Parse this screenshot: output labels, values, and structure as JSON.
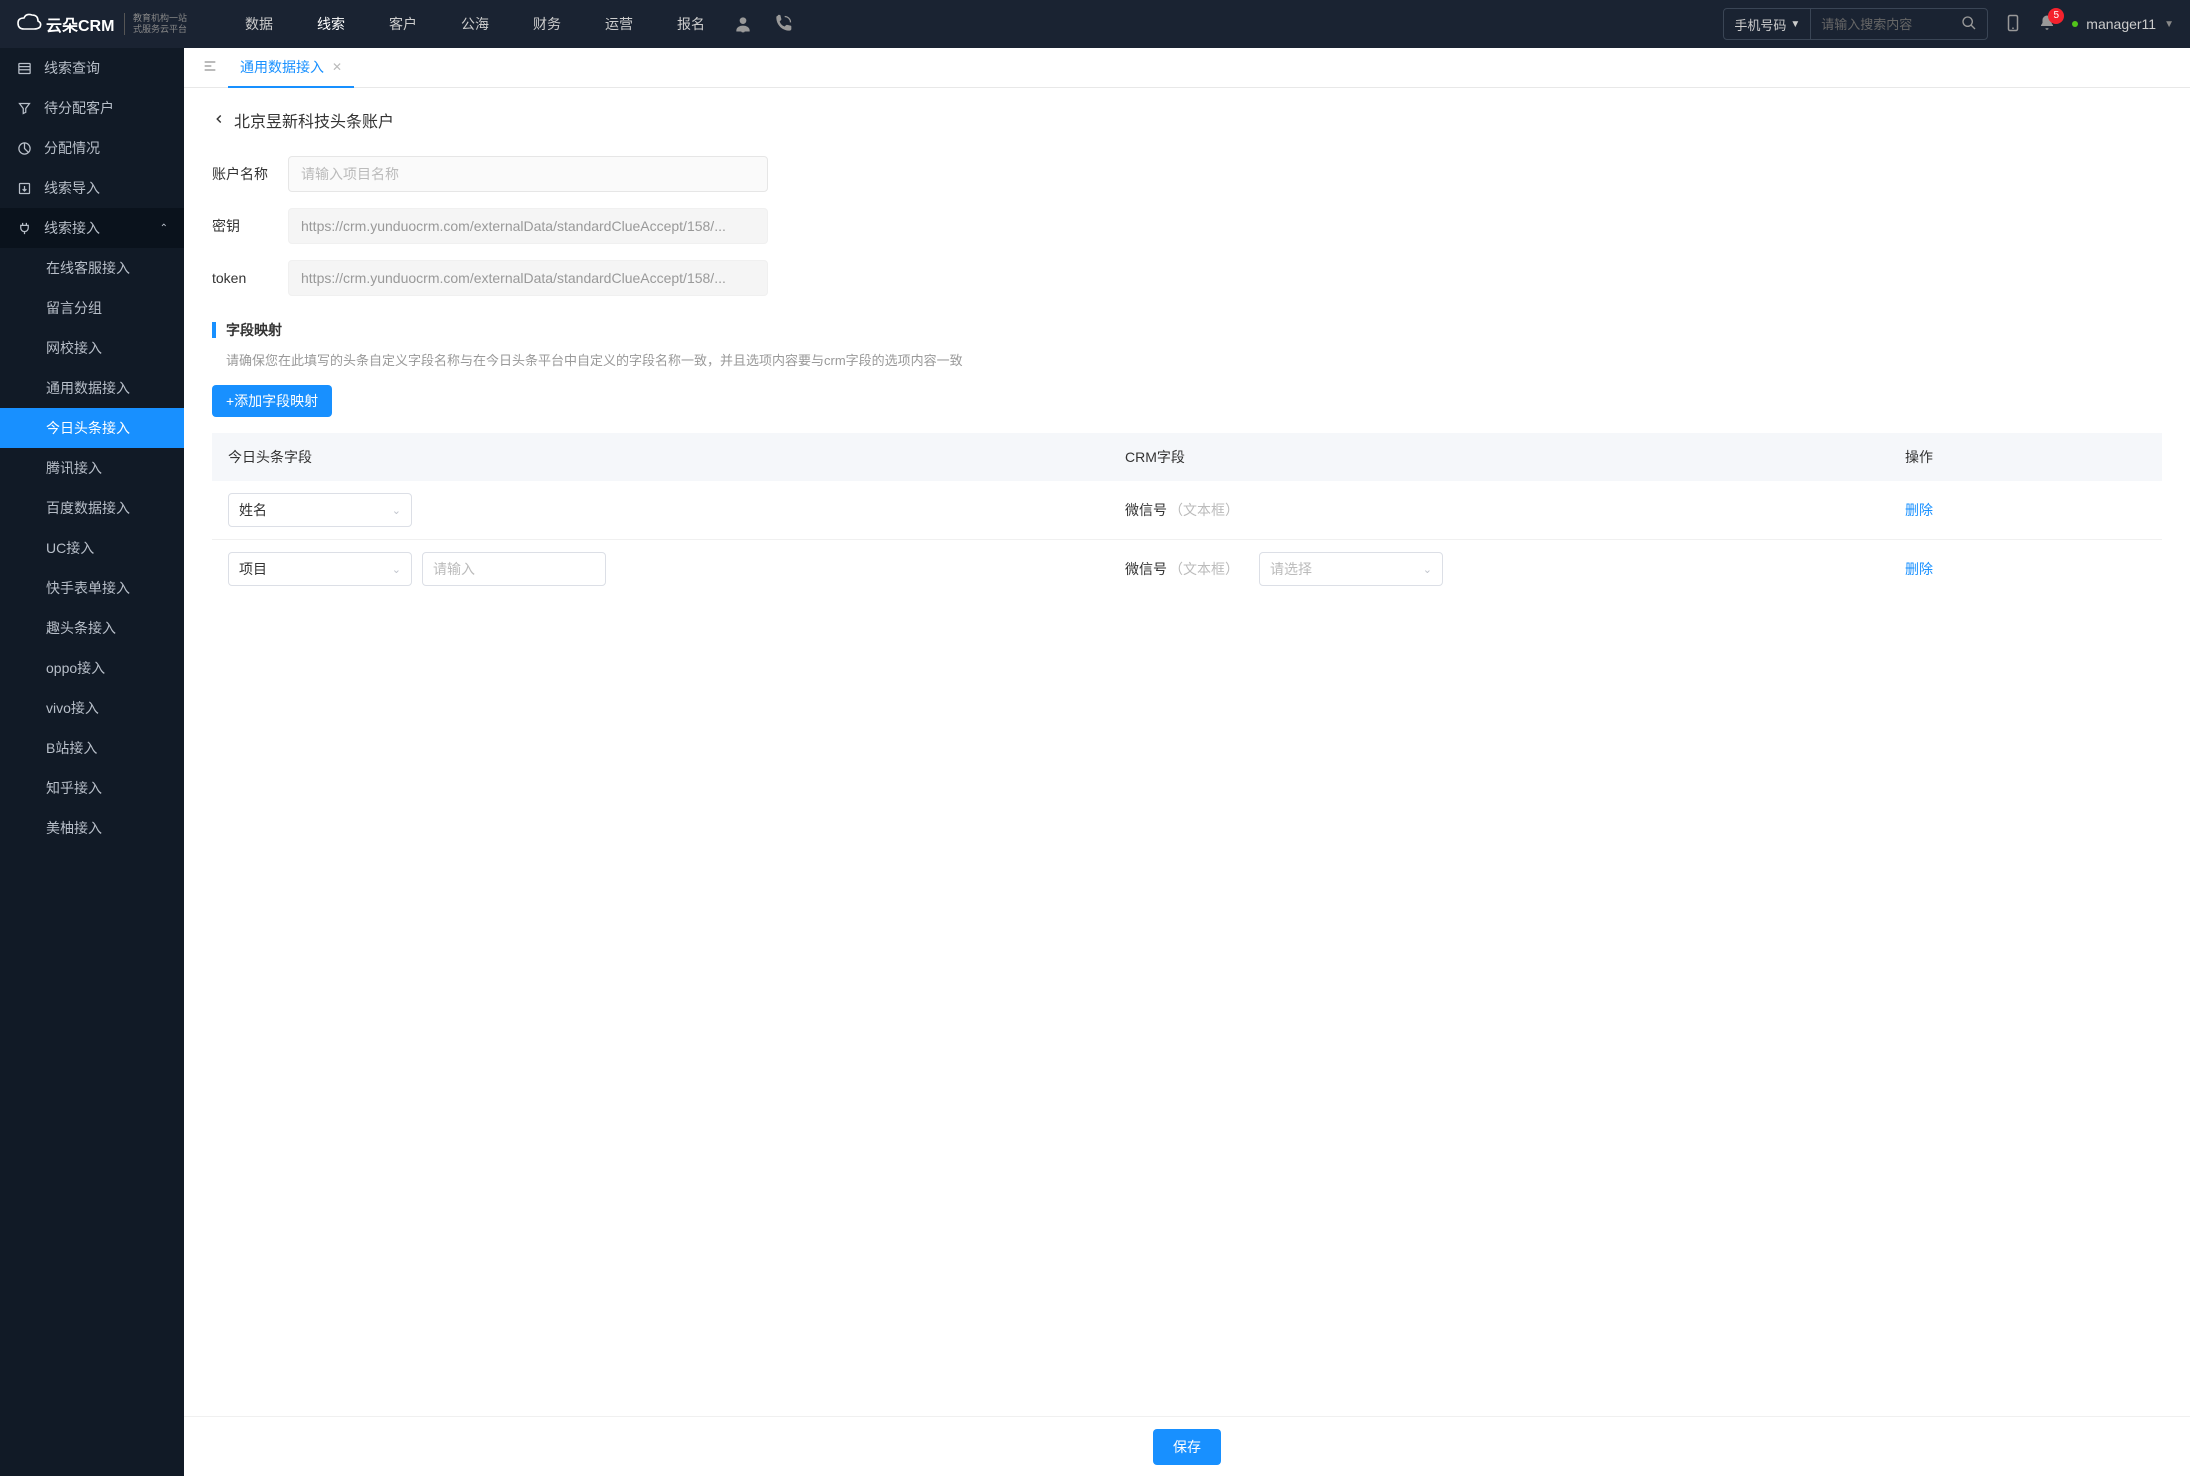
{
  "logoText": "云朵CRM",
  "logoSub1": "教育机构一站",
  "logoSub2": "式服务云平台",
  "nav": [
    "数据",
    "线索",
    "客户",
    "公海",
    "财务",
    "运营",
    "报名"
  ],
  "navActiveIndex": 1,
  "search": {
    "type": "手机号码",
    "placeholder": "请输入搜索内容"
  },
  "badge": "5",
  "user": "manager11",
  "sidebar": {
    "items": [
      {
        "label": "线索查询"
      },
      {
        "label": "待分配客户"
      },
      {
        "label": "分配情况"
      },
      {
        "label": "线索导入"
      },
      {
        "label": "线索接入",
        "expanded": true
      }
    ],
    "subitems": [
      "在线客服接入",
      "留言分组",
      "网校接入",
      "通用数据接入",
      "今日头条接入",
      "腾讯接入",
      "百度数据接入",
      "UC接入",
      "快手表单接入",
      "趣头条接入",
      "oppo接入",
      "vivo接入",
      "B站接入",
      "知乎接入",
      "美柚接入"
    ],
    "subActiveIndex": 4
  },
  "tab": {
    "label": "通用数据接入"
  },
  "breadcrumb": "北京昱新科技头条账户",
  "form": {
    "accountLabel": "账户名称",
    "accountPlaceholder": "请输入项目名称",
    "secretLabel": "密钥",
    "secretValue": "https://crm.yunduocrm.com/externalData/standardClueAccept/158/...",
    "tokenLabel": "token",
    "tokenValue": "https://crm.yunduocrm.com/externalData/standardClueAccept/158/..."
  },
  "mapping": {
    "title": "字段映射",
    "desc": "请确保您在此填写的头条自定义字段名称与在今日头条平台中自定义的字段名称一致，并且选项内容要与crm字段的选项内容一致",
    "addBtn": "+添加字段映射",
    "cols": {
      "c1": "今日头条字段",
      "c2": "CRM字段",
      "c3": "操作"
    },
    "rows": [
      {
        "field": "姓名",
        "crm": "微信号",
        "crmHint": "（文本框）",
        "extraInput": false,
        "crmSelect": false
      },
      {
        "field": "项目",
        "crm": "微信号",
        "crmHint": "（文本框）",
        "extraInput": true,
        "extraPlaceholder": "请输入",
        "crmSelect": true,
        "crmSelectPlaceholder": "请选择"
      }
    ],
    "delete": "删除"
  },
  "saveBtn": "保存"
}
